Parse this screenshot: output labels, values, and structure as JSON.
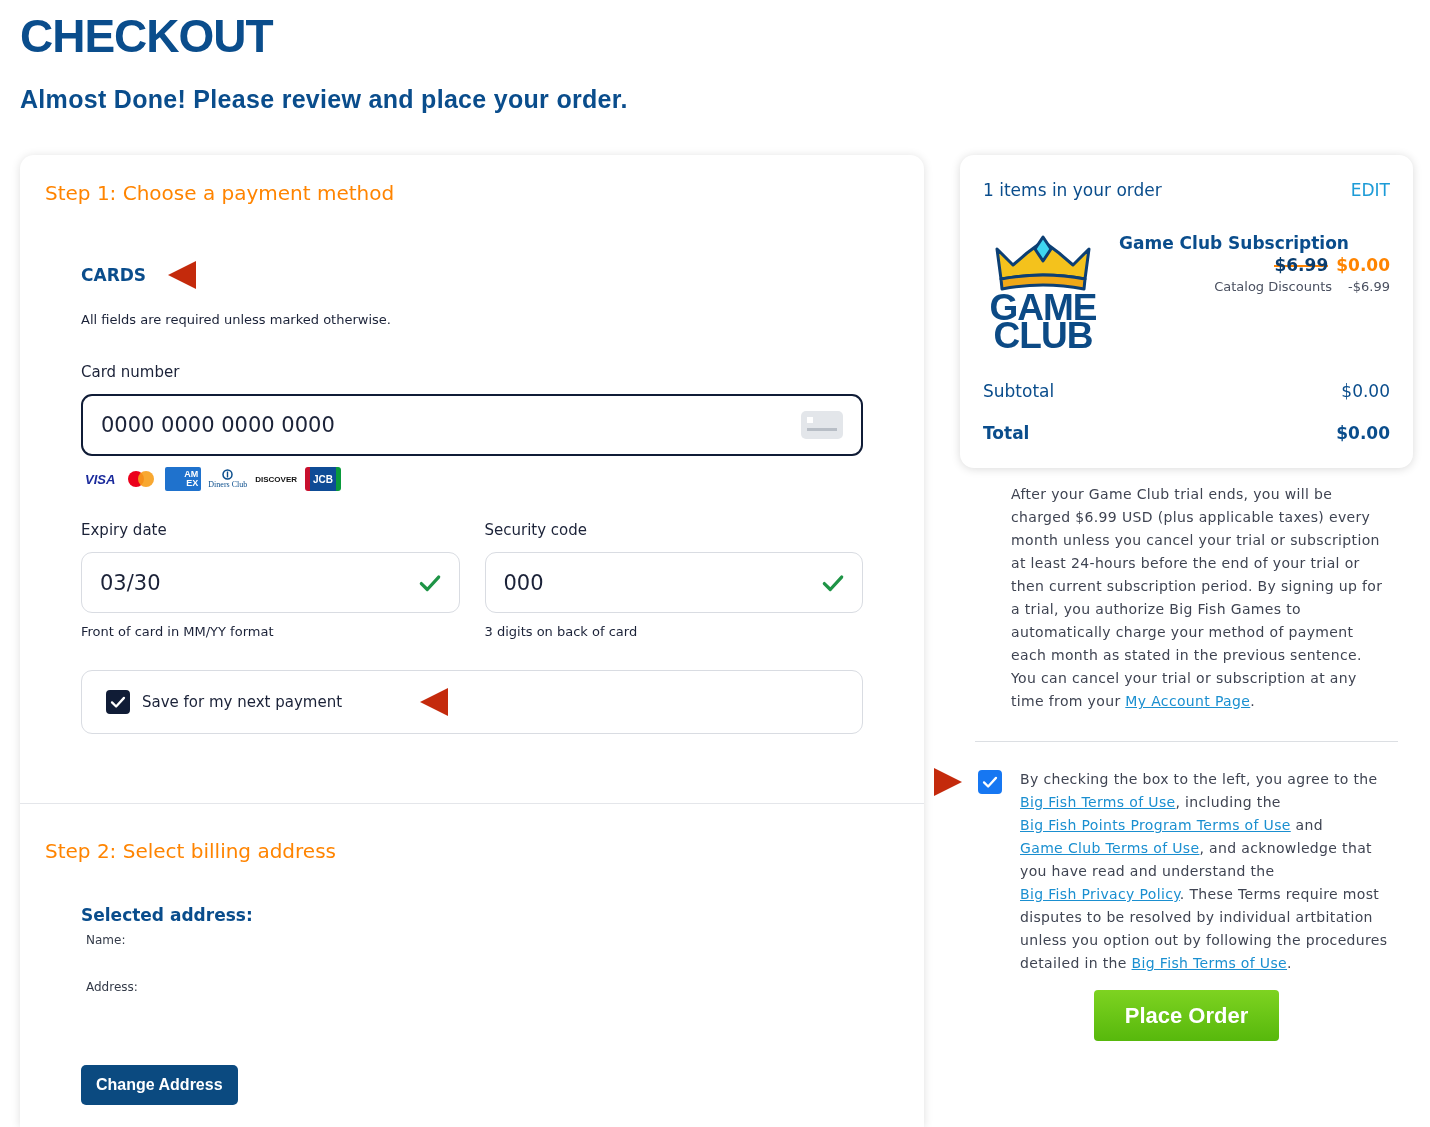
{
  "page": {
    "title": "CHECKOUT",
    "subtitle": "Almost Done! Please review and place your order."
  },
  "payment": {
    "step_title": "Step 1: Choose a payment method",
    "section_title": "CARDS",
    "required_note": "All fields are required unless marked otherwise.",
    "card_number": {
      "label": "Card number",
      "value": "0000 0000 0000 0000"
    },
    "card_brands": [
      {
        "kind": "visa",
        "label": "VISA"
      },
      {
        "kind": "mastercard"
      },
      {
        "kind": "amex",
        "label": "AM EX"
      },
      {
        "kind": "diners",
        "label": "Diners Club"
      },
      {
        "kind": "discover",
        "label": "DISCOVER"
      },
      {
        "kind": "jcb",
        "label": "JCB"
      }
    ],
    "fields": [
      {
        "label": "Expiry date",
        "value": "03/30",
        "valid": true,
        "hint": "Front of card in MM/YY format"
      },
      {
        "label": "Security code",
        "value": "000",
        "valid": true,
        "hint": "3 digits on back of card"
      }
    ],
    "save_card": {
      "label": "Save for my next payment",
      "checked": true
    }
  },
  "billing": {
    "step_title": "Step 2: Select billing address",
    "heading": "Selected address:",
    "name_label": "Name:",
    "address_label": "Address:",
    "button": "Change Address"
  },
  "order": {
    "count_text": "1 items in your order",
    "edit": "EDIT",
    "item": {
      "logo_text": "GAME CLUB",
      "name": "Game Club Subscription",
      "old_price": "$6.99",
      "old_price_struck": true,
      "price": "$0.00",
      "discount_label": "Catalog Discounts",
      "discount": "-$6.99"
    },
    "subtotal_label": "Subtotal",
    "subtotal": "$0.00",
    "total_label": "Total",
    "total": "$0.00"
  },
  "disclaimer": [
    {
      "kind": "text",
      "text": "After your Game Club trial ends, you will be charged $6.99 USD (plus applicable taxes) every month unless you cancel your trial or subscription at least 24-hours before the end of your trial or then current subscription period. By signing up for a trial, you authorize Big Fish Games to automatically charge your method of payment each month as stated in the previous sentence. You can cancel your trial or subscription at any time from your "
    },
    {
      "kind": "link",
      "text": "My Account Page"
    },
    {
      "kind": "text",
      "text": "."
    }
  ],
  "terms": {
    "checked": true,
    "parts": [
      {
        "kind": "text",
        "text": "By checking the box to the left, you agree to the "
      },
      {
        "kind": "link",
        "text": "Big Fish Terms of Use"
      },
      {
        "kind": "text",
        "text": ", including the "
      },
      {
        "kind": "link",
        "text": "Big Fish Points Program Terms of Use"
      },
      {
        "kind": "text",
        "text": " and "
      },
      {
        "kind": "link",
        "text": "Game Club Terms of Use"
      },
      {
        "kind": "text",
        "text": ", and acknowledge that you have read and understand the "
      },
      {
        "kind": "link",
        "text": "Big Fish Privacy Policy"
      },
      {
        "kind": "text",
        "text": ". These Terms require most disputes to be resolved by individual artbitation unless you option out by following the procedures detailed in the "
      },
      {
        "kind": "link",
        "text": "Big Fish Terms of Use"
      },
      {
        "kind": "text",
        "text": "."
      }
    ]
  },
  "place_order": "Place Order"
}
